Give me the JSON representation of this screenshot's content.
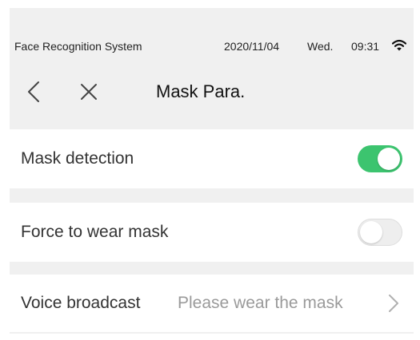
{
  "status_bar": {
    "app_name": "Face Recognition System",
    "date": "2020/11/04",
    "weekday": "Wed.",
    "time": "09:31",
    "wifi_icon": "wifi-icon"
  },
  "nav": {
    "back_icon": "chevron-left-icon",
    "close_icon": "close-icon",
    "title": "Mask Para."
  },
  "settings": [
    {
      "label": "Mask detection",
      "control": "toggle",
      "enabled": true
    },
    {
      "label": "Force to wear mask",
      "control": "toggle",
      "enabled": false
    },
    {
      "label": "Voice broadcast",
      "control": "select",
      "value": "Please wear the mask",
      "icon": "chevron-right-icon"
    }
  ],
  "colors": {
    "toggle_on": "#3cc46f",
    "toggle_off": "#eeeeee",
    "value_text": "#9a9a9a",
    "background": "#f0f0f0"
  }
}
